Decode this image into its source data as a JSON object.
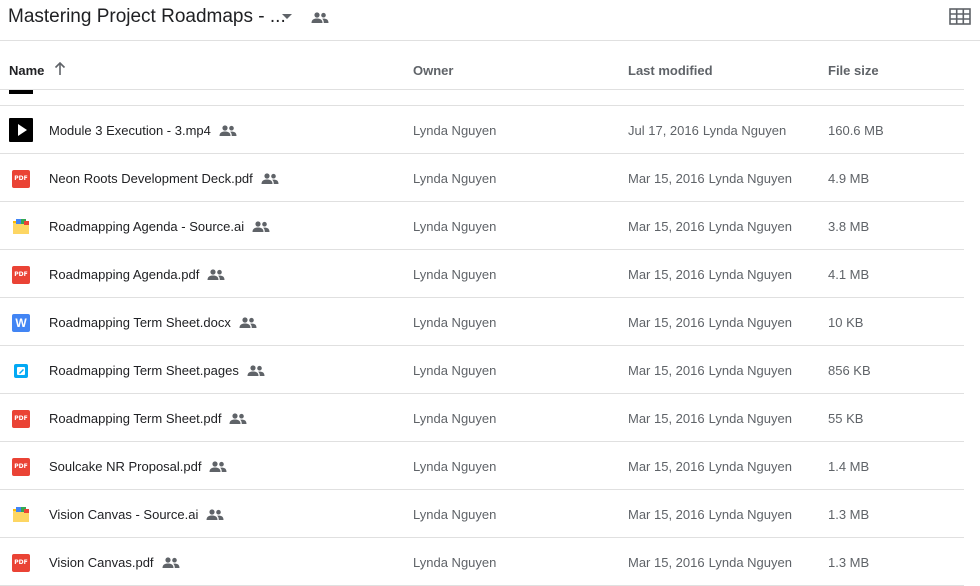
{
  "header": {
    "folder_title": "Mastering Project Roadmaps - ..."
  },
  "columns": {
    "name": "Name",
    "owner": "Owner",
    "last_modified": "Last modified",
    "file_size": "File size"
  },
  "files": [
    {
      "name": "Module 3 Execution - 3.mp4",
      "icon": "video-icon",
      "owner": "Lynda Nguyen",
      "date": "Jul 17, 2016",
      "modified_by": "Lynda Nguyen",
      "size": "160.6 MB"
    },
    {
      "name": "Neon Roots Development Deck.pdf",
      "icon": "pdf-icon",
      "owner": "Lynda Nguyen",
      "date": "Mar 15, 2016",
      "modified_by": "Lynda Nguyen",
      "size": "4.9 MB"
    },
    {
      "name": "Roadmapping Agenda - Source.ai",
      "icon": "illustrator-icon",
      "owner": "Lynda Nguyen",
      "date": "Mar 15, 2016",
      "modified_by": "Lynda Nguyen",
      "size": "3.8 MB"
    },
    {
      "name": "Roadmapping Agenda.pdf",
      "icon": "pdf-icon",
      "owner": "Lynda Nguyen",
      "date": "Mar 15, 2016",
      "modified_by": "Lynda Nguyen",
      "size": "4.1 MB"
    },
    {
      "name": "Roadmapping Term Sheet.docx",
      "icon": "word-icon",
      "owner": "Lynda Nguyen",
      "date": "Mar 15, 2016",
      "modified_by": "Lynda Nguyen",
      "size": "10 KB"
    },
    {
      "name": "Roadmapping Term Sheet.pages",
      "icon": "pages-icon",
      "owner": "Lynda Nguyen",
      "date": "Mar 15, 2016",
      "modified_by": "Lynda Nguyen",
      "size": "856 KB"
    },
    {
      "name": "Roadmapping Term Sheet.pdf",
      "icon": "pdf-icon",
      "owner": "Lynda Nguyen",
      "date": "Mar 15, 2016",
      "modified_by": "Lynda Nguyen",
      "size": "55 KB"
    },
    {
      "name": "Soulcake NR Proposal.pdf",
      "icon": "pdf-icon",
      "owner": "Lynda Nguyen",
      "date": "Mar 15, 2016",
      "modified_by": "Lynda Nguyen",
      "size": "1.4 MB"
    },
    {
      "name": "Vision Canvas - Source.ai",
      "icon": "illustrator-icon",
      "owner": "Lynda Nguyen",
      "date": "Mar 15, 2016",
      "modified_by": "Lynda Nguyen",
      "size": "1.3 MB"
    },
    {
      "name": "Vision Canvas.pdf",
      "icon": "pdf-icon",
      "owner": "Lynda Nguyen",
      "date": "Mar 15, 2016",
      "modified_by": "Lynda Nguyen",
      "size": "1.3 MB"
    }
  ],
  "icon_labels": {
    "pdf": "PDF",
    "word": "W"
  },
  "colors": {
    "pdf": "#ea4335",
    "word": "#4285f4",
    "pages": "#03a9f4"
  }
}
